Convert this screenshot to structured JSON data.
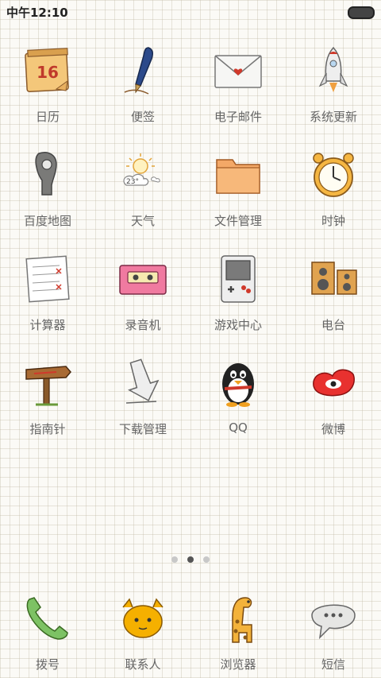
{
  "status_bar": {
    "time": "中午12:10"
  },
  "apps": [
    {
      "id": "calendar",
      "label": "日历",
      "icon": "calendar-icon",
      "date": "16"
    },
    {
      "id": "notes",
      "label": "便签",
      "icon": "pen-icon"
    },
    {
      "id": "email",
      "label": "电子邮件",
      "icon": "envelope-icon"
    },
    {
      "id": "system-update",
      "label": "系统更新",
      "icon": "rocket-icon"
    },
    {
      "id": "baidu-map",
      "label": "百度地图",
      "icon": "map-pin-icon"
    },
    {
      "id": "weather",
      "label": "天气",
      "icon": "weather-icon",
      "temp": "23°"
    },
    {
      "id": "file-manager",
      "label": "文件管理",
      "icon": "folder-icon"
    },
    {
      "id": "clock",
      "label": "时钟",
      "icon": "alarm-clock-icon"
    },
    {
      "id": "calculator",
      "label": "计算器",
      "icon": "calculator-paper-icon"
    },
    {
      "id": "recorder",
      "label": "录音机",
      "icon": "cassette-icon"
    },
    {
      "id": "game-center",
      "label": "游戏中心",
      "icon": "game-console-icon"
    },
    {
      "id": "radio",
      "label": "电台",
      "icon": "speakers-icon"
    },
    {
      "id": "compass",
      "label": "指南针",
      "icon": "signpost-icon"
    },
    {
      "id": "download-manager",
      "label": "下载管理",
      "icon": "download-icon"
    },
    {
      "id": "qq",
      "label": "QQ",
      "icon": "penguin-icon"
    },
    {
      "id": "weibo",
      "label": "微博",
      "icon": "weibo-icon"
    }
  ],
  "page_indicator": {
    "count": 3,
    "active": 2
  },
  "dock": [
    {
      "id": "dialer",
      "label": "拨号",
      "icon": "phone-icon"
    },
    {
      "id": "contacts",
      "label": "联系人",
      "icon": "contacts-icon"
    },
    {
      "id": "browser",
      "label": "浏览器",
      "icon": "giraffe-icon"
    },
    {
      "id": "sms",
      "label": "短信",
      "icon": "chat-bubble-icon"
    }
  ]
}
